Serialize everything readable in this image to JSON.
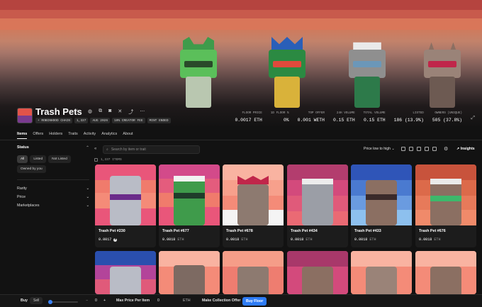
{
  "collection": {
    "name": "Trash Pets",
    "tags": [
      "+ ROBINHOOD CHAIN",
      "1,337",
      "AUG 2026",
      "10% CREATOR FEE",
      "MINT ENDED"
    ]
  },
  "header_icons": [
    "star-icon",
    "globe-icon",
    "copy-icon",
    "discord-icon",
    "x-icon",
    "share-icon",
    "more-icon"
  ],
  "stats": [
    {
      "label": "FLOOR PRICE",
      "value": "0.0017 ETH"
    },
    {
      "label": "1D FLOOR %",
      "value": "0%"
    },
    {
      "label": "TOP OFFER",
      "value": "0.001 WETH"
    },
    {
      "label": "24H VOLUME",
      "value": "0.15 ETH"
    },
    {
      "label": "TOTAL VOLUME",
      "value": "0.15 ETH"
    },
    {
      "label": "LISTED",
      "value": "186 (13.9%)"
    },
    {
      "label": "OWNERS (UNIQUE)",
      "value": "505 (37.8%)"
    }
  ],
  "tabs": [
    "Items",
    "Offers",
    "Holders",
    "Traits",
    "Activity",
    "Analytics",
    "About"
  ],
  "sidebar": {
    "status_label": "Status",
    "status_chips": [
      "All",
      "Listed",
      "Not Listed",
      "Owned by you"
    ],
    "filters": [
      "Rarity",
      "Price",
      "Marketplaces"
    ]
  },
  "toolbar": {
    "search_placeholder": "Search by item or trait",
    "sort_label": "Price low to high",
    "insights_label": "Insights"
  },
  "items_count": "1,337 ITEMS",
  "items": [
    {
      "name": "Trash Pet #230",
      "price": "0.0017",
      "currency": "ETH"
    },
    {
      "name": "Trash Pet #677",
      "price": "0.0018",
      "currency": "ETH"
    },
    {
      "name": "Trash Pet #678",
      "price": "0.0018",
      "currency": "ETH"
    },
    {
      "name": "Trash Pet #434",
      "price": "0.0018",
      "currency": "ETH"
    },
    {
      "name": "Trash Pet #433",
      "price": "0.0018",
      "currency": "ETH"
    },
    {
      "name": "Trash Pet #676",
      "price": "0.0018",
      "currency": "ETH"
    }
  ],
  "bottom_bar": {
    "buy_label": "Buy",
    "sell_label": "Sell",
    "qty_minus": "−",
    "qty_value": "0",
    "qty_plus": "+",
    "max_price_label": "Max Price Per Item",
    "max_price_value": "0",
    "max_price_currency": "ETH",
    "offer_label": "Make Collection Offer",
    "buy_floor_label": "Buy Floor"
  },
  "colors": {
    "accent": "#2e7cf6",
    "background": "#121212"
  }
}
